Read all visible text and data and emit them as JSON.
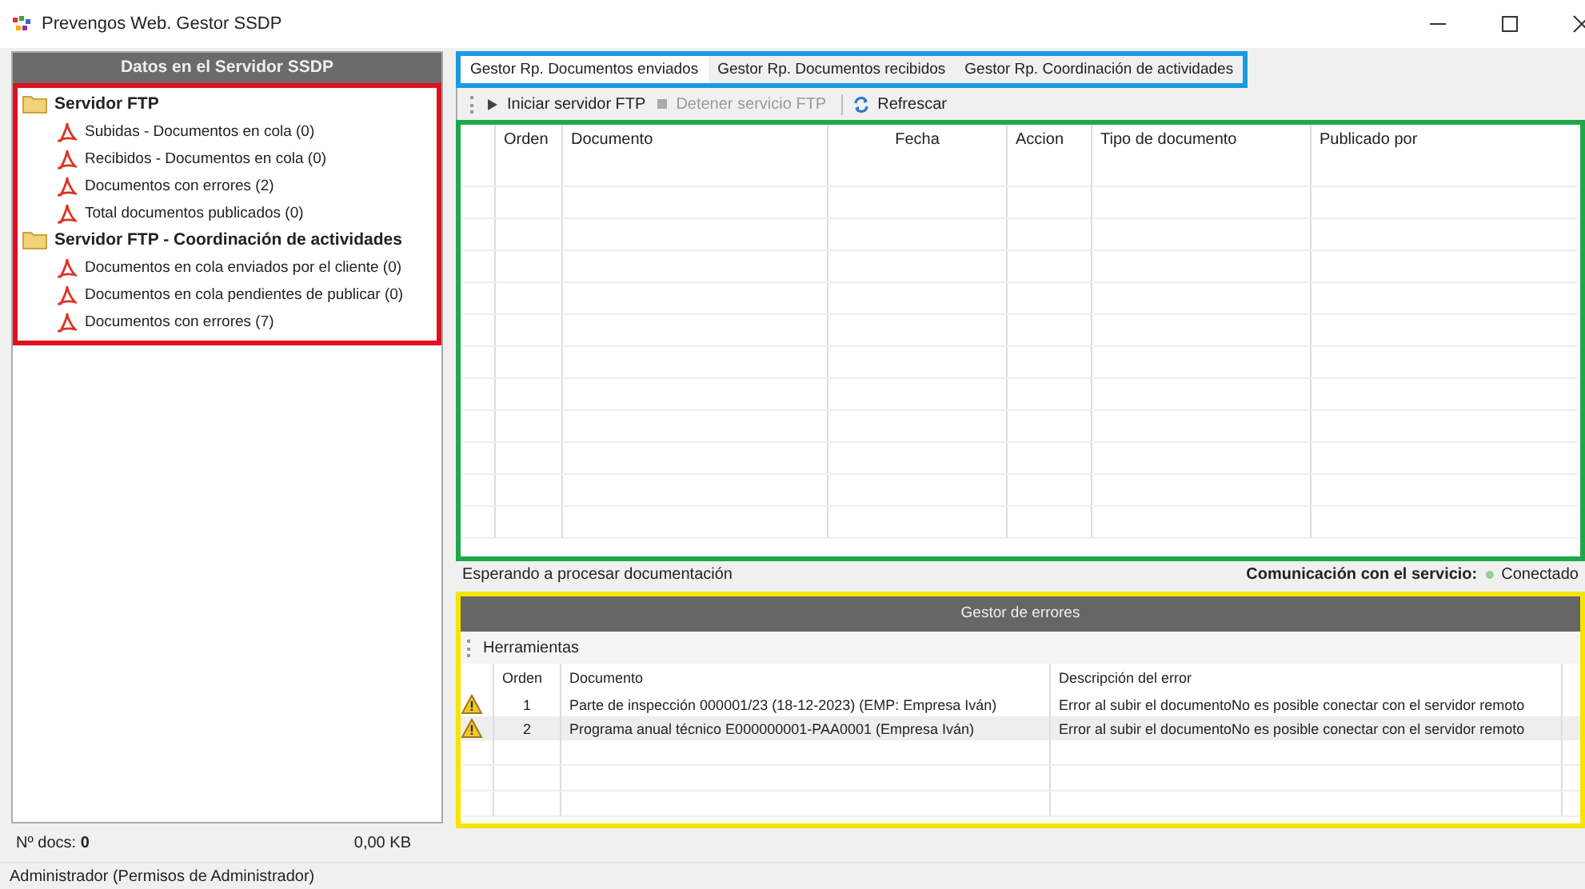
{
  "window": {
    "title": "Prevengos Web. Gestor SSDP"
  },
  "sidebar": {
    "title": "Datos en el Servidor SSDP",
    "tree": [
      {
        "label": "Servidor FTP",
        "kind": "folder",
        "children": [
          {
            "label": "Subidas - Documentos en cola (0)",
            "kind": "document"
          },
          {
            "label": "Recibidos - Documentos en cola (0)",
            "kind": "document"
          },
          {
            "label": "Documentos con errores (2)",
            "kind": "document"
          },
          {
            "label": "Total documentos publicados (0)",
            "kind": "document"
          }
        ]
      },
      {
        "label": "Servidor FTP - Coordinación de actividades",
        "kind": "folder",
        "children": [
          {
            "label": "Documentos en cola enviados por el cliente (0)",
            "kind": "document"
          },
          {
            "label": "Documentos en cola pendientes de publicar (0)",
            "kind": "document"
          },
          {
            "label": "Documentos con errores (7)",
            "kind": "document"
          }
        ]
      }
    ],
    "status": {
      "count_label": "Nº docs:",
      "count": "0",
      "size": "0,00 KB"
    }
  },
  "tabs": [
    {
      "label": "Gestor Rp. Documentos enviados",
      "selected": true
    },
    {
      "label": "Gestor Rp. Documentos recibidos",
      "selected": false
    },
    {
      "label": "Gestor Rp. Coordinación de actividades",
      "selected": false
    }
  ],
  "toolbar": [
    {
      "label": "Iniciar servidor FTP",
      "kind": "play",
      "disabled": false
    },
    {
      "label": "Detener servicio FTP",
      "kind": "stop",
      "disabled": true
    },
    {
      "label": "Refrescar",
      "kind": "refresh",
      "disabled": false
    }
  ],
  "table": {
    "columns": [
      "Orden",
      "Documento",
      "Fecha",
      "Accion",
      "Tipo de documento",
      "Publicado por"
    ]
  },
  "status_line": {
    "message": "Esperando a procesar documentación",
    "service_label": "Comunicación con el servicio:",
    "service_state": "Conectado",
    "connected": true
  },
  "errors": {
    "title": "Gestor de errores",
    "toolbar": "Herramientas",
    "columns": [
      "Orden",
      "Documento",
      "Descripción del error"
    ],
    "rows": [
      {
        "order": "1",
        "document": "Parte de inspección 000001/23 (18-12-2023) (EMP: Empresa Iván)",
        "description": "Error al subir el documentoNo es posible conectar con el servidor remoto"
      },
      {
        "order": "2",
        "document": "Programa anual técnico E000000001-PAA0001 (Empresa Iván)",
        "description": "Error al subir el documentoNo es posible conectar con el servidor remoto"
      }
    ]
  },
  "status_bar": "Administrador (Permisos de Administrador)"
}
